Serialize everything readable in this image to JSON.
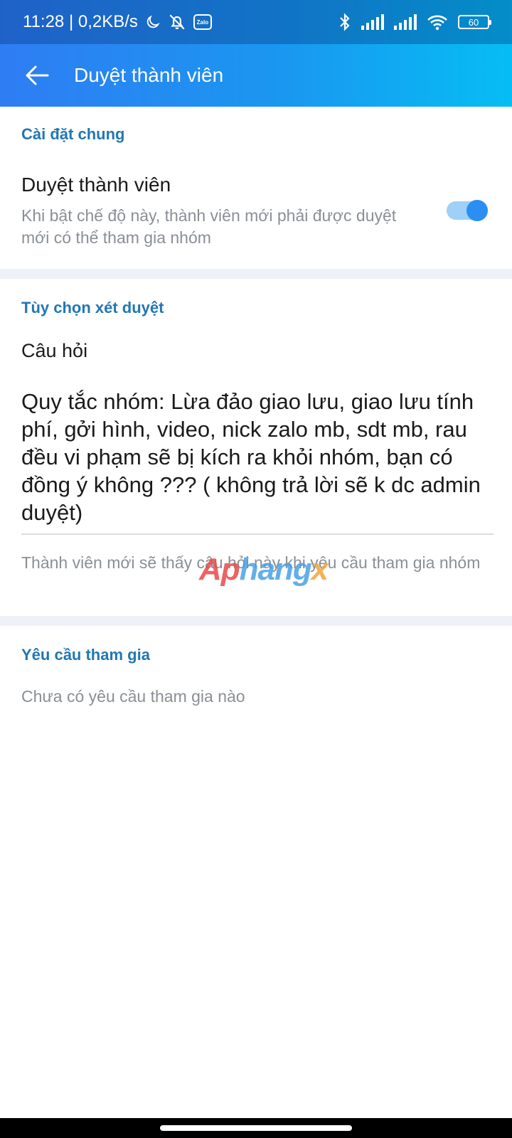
{
  "status_bar": {
    "time_speed": "11:28 | 0,2KB/s",
    "zalo_badge": "Zalo",
    "battery": "60",
    "icons": [
      "moon-icon",
      "bell-off-icon",
      "zalo-icon",
      "bluetooth-icon",
      "signal-icon",
      "signal-icon",
      "wifi-icon",
      "battery-icon"
    ]
  },
  "app_bar": {
    "title": "Duyệt thành viên",
    "back_icon": "arrow-left-icon"
  },
  "sections": {
    "general": {
      "header": "Cài đặt chung",
      "setting_title": "Duyệt thành viên",
      "setting_desc": "Khi bật chế độ này, thành viên mới phải được duyệt mới có thể tham gia nhóm",
      "toggle_on": true
    },
    "review_options": {
      "header": "Tùy chọn xét duyệt",
      "question_label": "Câu hỏi",
      "question_text": "Quy tắc nhóm: Lừa đảo giao lưu, giao lưu tính phí, gởi hình, video, nick zalo mb, sdt mb, rau đều vi phạm sẽ bị kích ra khỏi nhóm, bạn có đồng ý không ??? ( không trả lời sẽ k dc admin duyệt)",
      "hint": "Thành viên mới sẽ thấy câu hỏi này khi yêu cầu tham gia nhóm"
    },
    "join_requests": {
      "header": "Yêu cầu tham gia",
      "empty": "Chưa có yêu cầu tham gia nào"
    }
  },
  "watermark": {
    "part_a": "Ap",
    "part_b": "hang",
    "part_c": "x"
  },
  "colors": {
    "accent": "#2277b3",
    "toggle_knob": "#2b8ef3",
    "toggle_track": "#9fd0f7",
    "header_gradient_start": "#2f7df3",
    "header_gradient_end": "#06bdf4"
  }
}
